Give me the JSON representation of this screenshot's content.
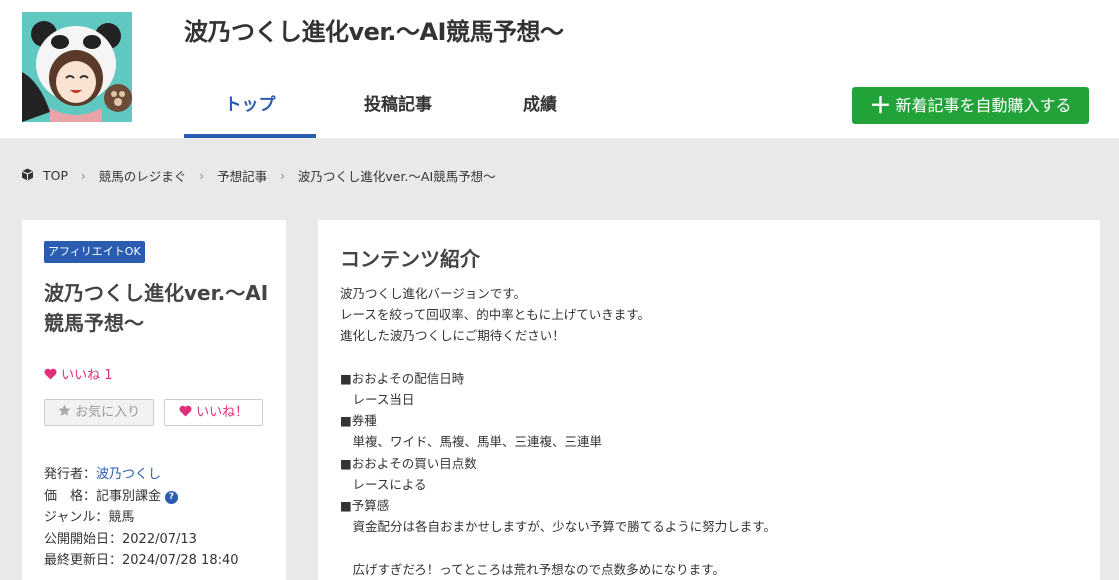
{
  "header": {
    "title": "波乃つくし進化ver.〜AI競馬予想〜",
    "tabs": [
      "トップ",
      "投稿記事",
      "成績"
    ],
    "buy_button": "新着記事を自動購入する",
    "plus_glyph": "＋"
  },
  "breadcrumb": {
    "items": [
      "TOP",
      "競馬のレジまぐ",
      "予想記事",
      "波乃つくし進化ver.〜AI競馬予想〜"
    ],
    "separator": "›"
  },
  "sidebar": {
    "badge": "アフィリエイトOK",
    "title": "波乃つくし進化ver.〜AI競馬予想〜",
    "likes_label": "いいね",
    "likes_count": "1",
    "favorite_button": "お気に入り",
    "like_button": "いいね！",
    "publisher_label": "発行者：",
    "publisher": "波乃つくし",
    "price_label": "価　格：",
    "price": "記事別課金",
    "genre": "ジャンル：競馬",
    "start_date": "公開開始日：2022/07/13",
    "updated": "最終更新日：2024/07/28 18:40"
  },
  "main": {
    "heading": "コンテンツ紹介",
    "body": "波乃つくし進化バージョンです。\nレースを絞って回収率、的中率ともに上げていきます。\n進化した波乃つくしにご期待ください！\n\n■おおよその配信日時\n　レース当日\n■券種\n　単複、ワイド、馬複、馬単、三連複、三連単\n■おおよその買い目点数\n　レースによる\n■予算感\n　資金配分は各自おまかせしますが、少ない予算で勝てるように努力します。\n\n　広げすぎだろ！ってところは荒れ予想なので点数多めになります。"
  },
  "colors": {
    "accent": "#2a5db0",
    "buy_green": "#22a33a",
    "like_pink": "#e0307a",
    "background": "#e9e9e9"
  }
}
